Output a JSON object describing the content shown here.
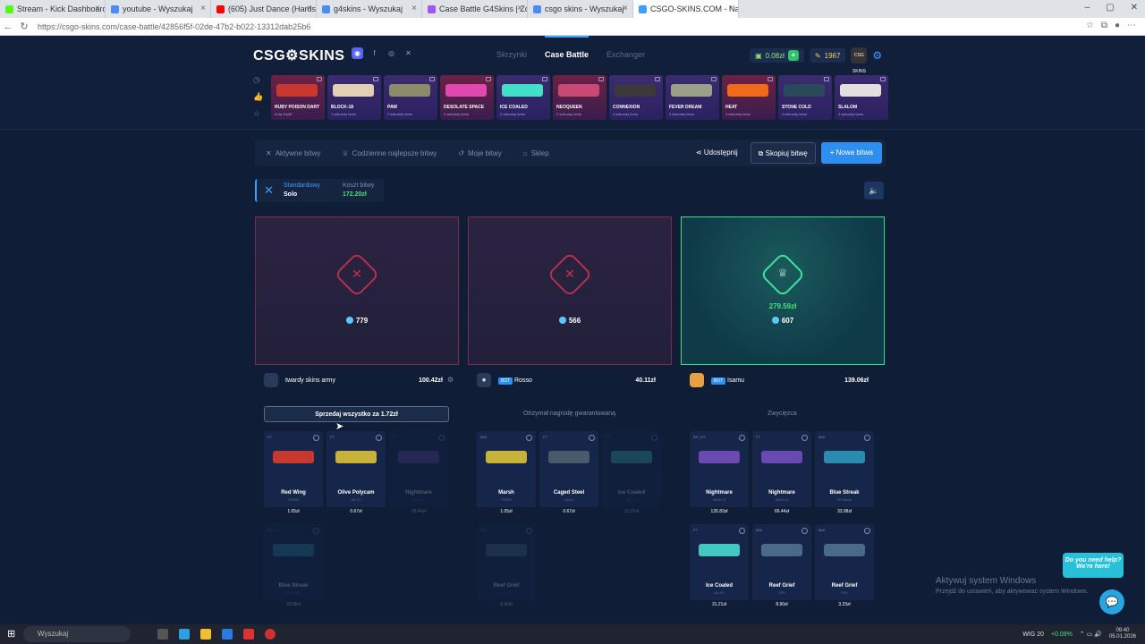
{
  "browser": {
    "tabs": [
      {
        "label": "Stream - Kick Dashboard",
        "color": "#53fc18"
      },
      {
        "label": "youtube - Wyszukaj",
        "color": "#4b8bf5"
      },
      {
        "label": "(605) Just Dance (Hardstyle)",
        "color": "#ff0000"
      },
      {
        "label": "g4skins - Wyszukaj",
        "color": "#4b8bf5"
      },
      {
        "label": "Case Battle G4Skins | Zdobywaj sk",
        "color": "#a254f5"
      },
      {
        "label": "csgo skins - Wyszukaj",
        "color": "#4b8bf5"
      },
      {
        "label": "CSGO-SKINS.COM - Najlepsz",
        "color": "#3aa0ff"
      }
    ],
    "url": "https://csgo-skins.com/case-battle/42856f5f-02de-47b2-b022-13312dab25b6"
  },
  "header": {
    "logo": "CSG⚙SKINS",
    "nav": [
      "Skrzynki",
      "Case Battle",
      "Exchanger"
    ],
    "balance": "0.08zł",
    "points": "1967",
    "avatar_text": "CSG SKINS"
  },
  "drops": [
    {
      "name": "RUBY POISON DART",
      "sub": "w tej chwili",
      "gun": "#c8382f",
      "red": true
    },
    {
      "name": "BLOCK-18",
      "sub": "1 sekundy temu",
      "gun": "#e2d0b5",
      "red": false
    },
    {
      "name": "PAW",
      "sub": "2 sekundy temu",
      "gun": "#8c8c6a",
      "red": false
    },
    {
      "name": "DESOLATE SPACE",
      "sub": "2 sekundy temu",
      "gun": "#e04ab0",
      "red": true
    },
    {
      "name": "ICE COALED",
      "sub": "2 sekundy temu",
      "gun": "#42e0c8",
      "red": false
    },
    {
      "name": "NEOQUEEN",
      "sub": "2 sekundy temu",
      "gun": "#c84a74",
      "red": true
    },
    {
      "name": "CONNEXION",
      "sub": "3 sekundy temu",
      "gun": "#3a3a3a",
      "red": false
    },
    {
      "name": "FEVER DREAM",
      "sub": "3 sekundy temu",
      "gun": "#9aa08a",
      "red": false
    },
    {
      "name": "HEAT",
      "sub": "3 sekundy temu",
      "gun": "#f06a1a",
      "red": true
    },
    {
      "name": "STONE COLD",
      "sub": "4 sekundy temu",
      "gun": "#2a4a5a",
      "red": false
    },
    {
      "name": "SLALOM",
      "sub": "4 sekundy temu",
      "gun": "#e0e0e0",
      "red": false
    }
  ],
  "subnav": {
    "items": [
      "Aktywne bitwy",
      "Codzienne najlepsze bitwy",
      "Moje bitwy",
      "Sklep"
    ],
    "share": "Udostępnij",
    "copy": "Skopiuj bitwę",
    "new": "+ Nowa bitwa"
  },
  "mode": {
    "label": "Standardowy",
    "value": "Solo",
    "cost_label": "Koszt bitwy",
    "cost": "172.20zł"
  },
  "players": [
    {
      "name": "twardy skins army",
      "value": "100.42zł",
      "score": "779",
      "bot": false,
      "action": "Sprzedaj wszystko za 1.72zł",
      "action_is_button": true
    },
    {
      "name": "Rosso",
      "value": "40.11zł",
      "score": "566",
      "bot": true,
      "action": "Otrzymał nagrodę gwarantowaną",
      "action_is_button": false
    },
    {
      "name": "Isamu",
      "value": "139.06zł",
      "score": "607",
      "bot": true,
      "prize": "279.59zł",
      "action": "Zwycięzca",
      "action_is_button": false
    }
  ],
  "bot_label": "BOT",
  "items": [
    [
      {
        "name": "Red Wing",
        "skin": "P2000",
        "price": "1.05zł",
        "gun": "#c8382f",
        "dim": false,
        "tag": "FT"
      },
      {
        "name": "Olive Polycam",
        "skin": "AK-47",
        "price": "0.67zł",
        "gun": "#c8b23a",
        "dim": false,
        "tag": "FT"
      },
      {
        "name": "Nightmare",
        "skin": "M4A1-S",
        "price": "66.44zł",
        "gun": "#6a4ab0",
        "dim": true,
        "tag": "FT"
      },
      {
        "name": "Blue Streak",
        "skin": "PP-Bizon",
        "price": "33.98zł",
        "gun": "#2a8ab0",
        "dim": true,
        "tag": "MW"
      }
    ],
    [
      {
        "name": "Marsh",
        "skin": "P2000",
        "price": "1.05zł",
        "gun": "#c8b23a",
        "dim": false,
        "tag": "MW"
      },
      {
        "name": "Caged Steel",
        "skin": "Nova",
        "price": "0.67zł",
        "gun": "#4a5a6a",
        "dim": false,
        "tag": "FT"
      },
      {
        "name": "Ice Coaled",
        "skin": "AK-47",
        "price": "31.21zł",
        "gun": "#42c8c0",
        "dim": true,
        "tag": "FT"
      },
      {
        "name": "Reef Grief",
        "skin": "P90",
        "price": "8.90zł",
        "gun": "#4a6a8a",
        "dim": true,
        "tag": "MW"
      }
    ],
    [
      {
        "name": "Nightmare",
        "skin": "M4A1-S",
        "price": "135.83zł",
        "gun": "#6a4ab0",
        "dim": false,
        "tag": "BS | ST"
      },
      {
        "name": "Nightmare",
        "skin": "M4A1-S",
        "price": "66.44zł",
        "gun": "#6a4ab0",
        "dim": false,
        "tag": "FT"
      },
      {
        "name": "Blue Streak",
        "skin": "PP-Bizon",
        "price": "33.98zł",
        "gun": "#2a8ab0",
        "dim": false,
        "tag": "MW"
      },
      {
        "name": "Ice Coaled",
        "skin": "AK-47",
        "price": "31.21zł",
        "gun": "#42c8c0",
        "dim": false,
        "tag": "FT"
      },
      {
        "name": "Reef Grief",
        "skin": "P90",
        "price": "8.90zł",
        "gun": "#4a6a8a",
        "dim": false,
        "tag": "MW"
      },
      {
        "name": "Reef Grief",
        "skin": "P90",
        "price": "3.23zł",
        "gun": "#4a6a8a",
        "dim": false,
        "tag": "MW"
      }
    ]
  ],
  "windows": {
    "activate_title": "Aktywuj system Windows",
    "activate_sub": "Przejdź do ustawień, aby aktywować system Windows.",
    "help": "Do you need help? We're here!",
    "search": "Wyszukaj",
    "index": "WIG 20",
    "index_change": "+0.09%",
    "time": "09:40",
    "date": "05.01.2026"
  }
}
